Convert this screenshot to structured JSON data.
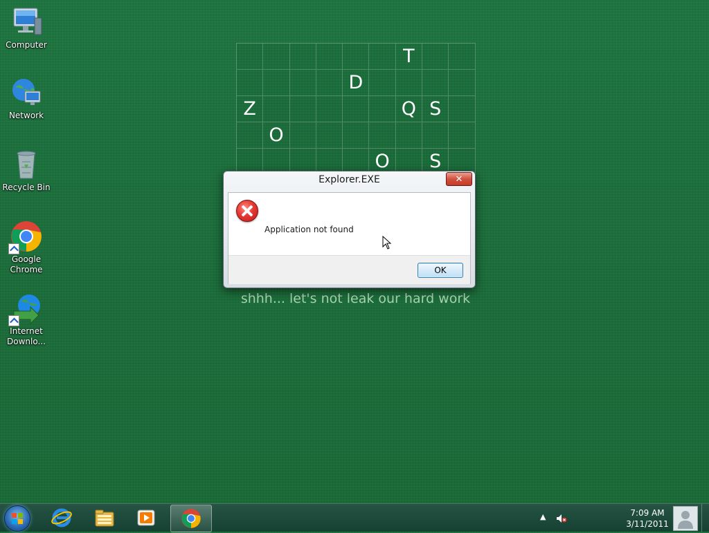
{
  "desktop": {
    "icons": [
      {
        "label": "Computer",
        "icon": "computer-icon"
      },
      {
        "label": "Network",
        "icon": "network-icon"
      },
      {
        "label": "Recycle Bin",
        "icon": "recycle-bin-icon"
      },
      {
        "label": "Google Chrome",
        "icon": "chrome-icon"
      },
      {
        "label": "Internet Downlo...",
        "icon": "internet-download-manager-icon"
      }
    ]
  },
  "wallpaper": {
    "grid_rows": [
      [
        "",
        "",
        "",
        "",
        "",
        "",
        "T",
        "",
        ""
      ],
      [
        "",
        "",
        "",
        "",
        "D",
        "",
        "",
        "",
        ""
      ],
      [
        "Z",
        "",
        "",
        "",
        "",
        "",
        "Q",
        "S",
        ""
      ],
      [
        "",
        "O",
        "",
        "",
        "",
        "",
        "",
        "",
        ""
      ],
      [
        "",
        "",
        "",
        "",
        "",
        "O",
        "",
        "S",
        ""
      ],
      [
        "",
        "",
        "",
        "",
        "",
        "",
        "",
        "",
        ""
      ]
    ],
    "tagline": "shhh... let's not leak our hard work"
  },
  "dialog": {
    "title": "Explorer.EXE",
    "close_label": "✕",
    "message": "Application not found",
    "ok_label": "OK"
  },
  "taskbar": {
    "items": [
      "internet-explorer-icon",
      "file-explorer-icon",
      "media-player-icon",
      "chrome-icon"
    ],
    "tray_arrow": "▲",
    "time": "7:09 AM",
    "date": "3/11/2011"
  },
  "colors": {
    "desktop_bg": "#1c6e3a",
    "dialog_close": "#c23b28",
    "ok_border": "#3c7fb1"
  }
}
